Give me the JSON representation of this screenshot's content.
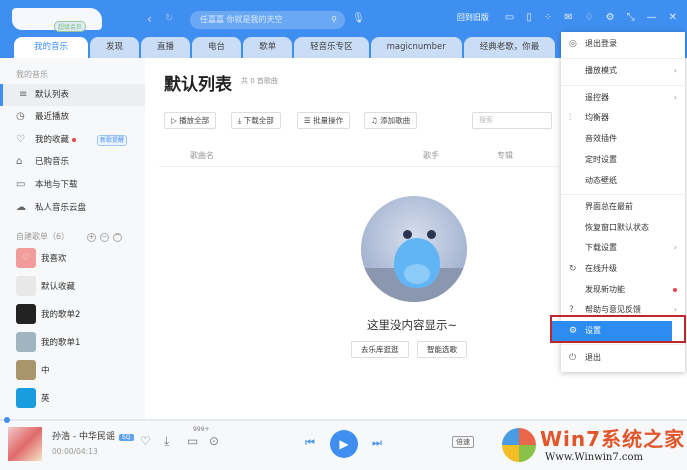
{
  "header": {
    "vip_badge": "超级会员",
    "back_icon": "‹",
    "refresh_icon": "↻",
    "search_placeholder": "任嘉嘉 你就是我的天空",
    "old_version": "回到旧版"
  },
  "tabs": [
    "我的音乐",
    "发现",
    "直播",
    "电台",
    "歌单",
    "轻音乐专区",
    "magicnumber",
    "经典老歌，你最"
  ],
  "sidebar": {
    "section_label": "我的音乐",
    "items": [
      {
        "label": "默认列表",
        "icon": "≡"
      },
      {
        "label": "最近播放",
        "icon": "◷"
      },
      {
        "label": "我的收藏",
        "icon": "♡",
        "badge": "新歌提醒"
      },
      {
        "label": "已购音乐",
        "icon": "⌂"
      },
      {
        "label": "本地与下载",
        "icon": "▭"
      },
      {
        "label": "私人音乐云盘",
        "icon": "☁"
      }
    ],
    "playlists_label": "自建歌单（6）",
    "playlists": [
      {
        "label": "我喜欢",
        "color": "#f29b9b"
      },
      {
        "label": "默认收藏",
        "color": "#e8e8e8"
      },
      {
        "label": "我的歌单2",
        "color": "#222"
      },
      {
        "label": "我的歌单1",
        "color": "#9fb6c0"
      },
      {
        "label": "中",
        "color": "#a8956a"
      },
      {
        "label": "英",
        "color": "#1a9de0"
      }
    ]
  },
  "main": {
    "title": "默认列表",
    "count": "共 0 首歌曲",
    "toolbar": [
      "▷ 播放全部",
      "⤓ 下载全部",
      "☰ 批量操作",
      "♫ 添加歌曲"
    ],
    "search_placeholder": "搜索",
    "columns": [
      "歌曲名",
      "歌手",
      "专辑"
    ],
    "empty_text": "这里没内容显示~",
    "empty_buttons": [
      "去乐库逛逛",
      "智能选歌"
    ]
  },
  "menu": {
    "items": [
      "退出登录",
      "播放模式",
      "遥控器",
      "均衡器",
      "音效插件",
      "定时设置",
      "动态壁纸",
      "界面总在最前",
      "恢复窗口默认状态",
      "下载设置",
      "在线升级",
      "发现新功能",
      "帮助与意见反馈",
      "设置",
      "退出"
    ]
  },
  "player": {
    "song": "孙浩 - 中华民谣",
    "quality": "SQ",
    "time": "00:00/04:13",
    "comments": "999+",
    "speed": "倍速"
  },
  "watermark": {
    "title": "Win7系统之家",
    "url": "Www.Winwin7.com"
  }
}
